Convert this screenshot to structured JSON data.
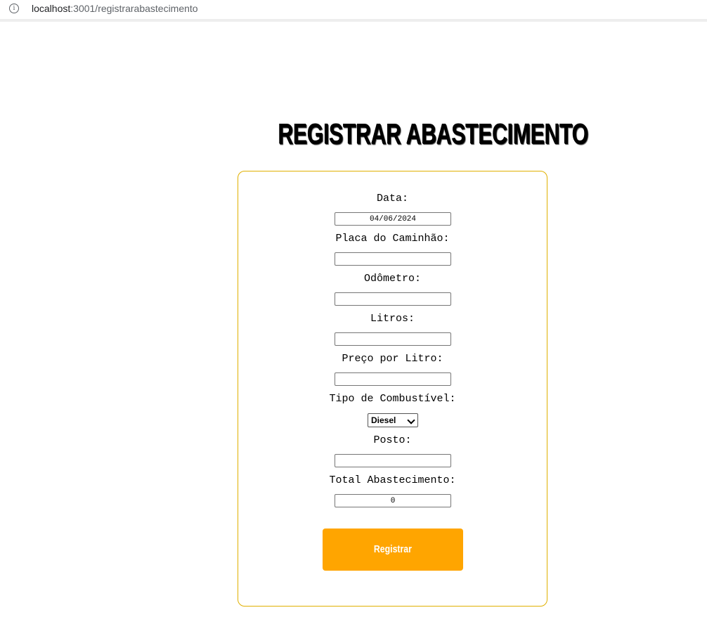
{
  "browser": {
    "url_host": "localhost",
    "url_path": ":3001/registrarabastecimento",
    "info_icon_glyph": "i"
  },
  "page": {
    "title": "REGISTRAR ABASTECIMENTO"
  },
  "form": {
    "data": {
      "label": "Data:",
      "value": "04/06/2024"
    },
    "placa": {
      "label": "Placa do Caminhão:",
      "value": ""
    },
    "odometro": {
      "label": "Odômetro:",
      "value": ""
    },
    "litros": {
      "label": "Litros:",
      "value": ""
    },
    "preco": {
      "label": "Preço por Litro:",
      "value": ""
    },
    "combustivel": {
      "label": "Tipo de Combustível:",
      "selected": "Diesel"
    },
    "posto": {
      "label": "Posto:",
      "value": ""
    },
    "total": {
      "label": "Total Abastecimento:",
      "value": "0"
    },
    "submit_label": "Registrar"
  },
  "colors": {
    "card_border": "#e0b000",
    "button_bg": "#ffa500",
    "button_text": "#ffffff"
  }
}
